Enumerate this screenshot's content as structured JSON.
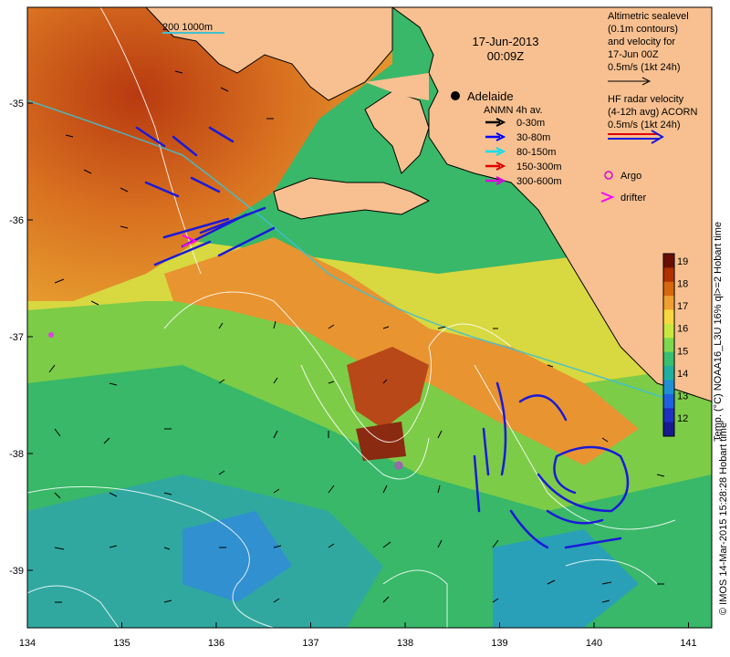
{
  "date": "17-Jun-2013",
  "time": "00:09Z",
  "scale_label": "200  1000m",
  "city": "Adelaide",
  "altimetry_legend": [
    "Altimetric sealevel",
    "(0.1m contours)",
    "and velocity for",
    "17-Jun 00Z",
    "0.5m/s (1kt 24h)"
  ],
  "hf_legend": [
    "HF radar velocity",
    "(4-12h avg) ACORN",
    "0.5m/s (1kt 24h)"
  ],
  "anmn_title": "ANMN 4h av.",
  "anmn_items": [
    {
      "label": "0-30m",
      "color": "#000000"
    },
    {
      "label": "30-80m",
      "color": "#0000ff"
    },
    {
      "label": "80-150m",
      "color": "#00e0f0"
    },
    {
      "label": "150-300m",
      "color": "#e00000"
    },
    {
      "label": "300-600m",
      "color": "#e000e0"
    }
  ],
  "argo_label": "Argo",
  "drifter_label": "drifter",
  "colorbar": {
    "ticks": [
      "19",
      "18",
      "17",
      "16",
      "15",
      "14",
      "13",
      "12"
    ],
    "label": "Temp. (°C) NOAA16_L3U 16% ql>=2      Hobart time",
    "colors": [
      "#6a0f00",
      "#b03000",
      "#d86810",
      "#f0a030",
      "#f8d840",
      "#c8e840",
      "#7cd850",
      "#38c070",
      "#20b0a0",
      "#2090d0",
      "#2060e0",
      "#2030c0",
      "#1a1a90"
    ]
  },
  "x_ticks": [
    "134",
    "135",
    "136",
    "137",
    "138",
    "139",
    "140",
    "141"
  ],
  "y_ticks": [
    "-35",
    "-36",
    "-37",
    "-38",
    "-39"
  ],
  "credit": "© IMOS 14-Mar-2015 15:28:28 Hobart time",
  "colors": {
    "land": "#f8c090",
    "border": "#000000"
  }
}
